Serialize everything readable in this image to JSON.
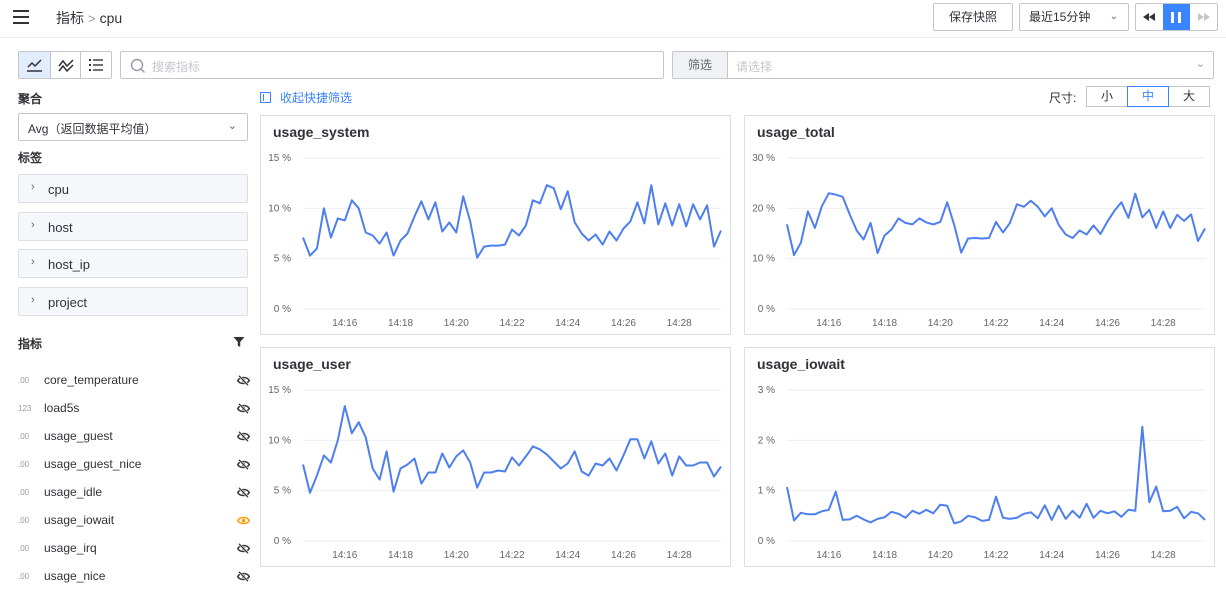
{
  "header": {
    "breadcrumb_root": "指标",
    "breadcrumb_sep": ">",
    "breadcrumb_current": "cpu",
    "save_label": "保存快照",
    "time_range": "最近15分钟"
  },
  "toolbar": {
    "search_placeholder": "搜索指标",
    "filter_label": "筛选",
    "filter_placeholder": "请选择",
    "collapse_label": "收起快捷筛选",
    "size_label": "尺寸:",
    "sizes": [
      "小",
      "中",
      "大"
    ],
    "active_size": "中"
  },
  "sidebar": {
    "agg_title": "聚合",
    "agg_value": "Avg（返回数据平均值）",
    "tags_title": "标签",
    "tags": [
      "cpu",
      "host",
      "host_ip",
      "project"
    ],
    "metrics_title": "指标",
    "metrics": [
      {
        "type": ".00",
        "name": "core_temperature",
        "visible": false
      },
      {
        "type": "123",
        "name": "load5s",
        "visible": false
      },
      {
        "type": ".00",
        "name": "usage_guest",
        "visible": false
      },
      {
        "type": ".00",
        "name": "usage_guest_nice",
        "visible": false
      },
      {
        "type": ".00",
        "name": "usage_idle",
        "visible": false
      },
      {
        "type": ".00",
        "name": "usage_iowait",
        "visible": true
      },
      {
        "type": ".00",
        "name": "usage_irq",
        "visible": false
      },
      {
        "type": ".00",
        "name": "usage_nice",
        "visible": false
      }
    ]
  },
  "colors": {
    "accent": "#3a84ff",
    "line": "#4e7ff0",
    "eye_active": "#ff9c01",
    "eye_hidden": "#313238"
  },
  "chart_data": [
    {
      "type": "line",
      "title": "usage_system",
      "y_ticks": [
        "0 %",
        "5 %",
        "10 %",
        "15 %"
      ],
      "ylim": [
        0,
        15
      ],
      "x_ticks": [
        "14:16",
        "14:18",
        "14:20",
        "14:22",
        "14:24",
        "14:26",
        "14:28"
      ],
      "x_tick_minutes": [
        16,
        18,
        20,
        22,
        24,
        26,
        28
      ],
      "xlim": [
        14.5,
        29.5
      ],
      "y": [
        7.1,
        5.3,
        6.0,
        10.0,
        7.1,
        9.0,
        8.8,
        10.8,
        10.0,
        7.6,
        7.3,
        6.5,
        7.6,
        5.3,
        6.8,
        7.5,
        9.2,
        10.7,
        8.9,
        10.6,
        7.7,
        8.6,
        7.6,
        11.2,
        8.7,
        5.1,
        6.2,
        6.3,
        6.3,
        6.4,
        7.9,
        7.3,
        8.3,
        10.8,
        10.5,
        12.3,
        12.0,
        9.9,
        11.7,
        8.6,
        7.5,
        6.8,
        7.4,
        6.4,
        7.7,
        6.8,
        8.0,
        8.7,
        10.6,
        8.5,
        12.3,
        8.4,
        10.5,
        8.3,
        10.4,
        8.2,
        10.4,
        8.9,
        10.3,
        6.2,
        7.8
      ]
    },
    {
      "type": "line",
      "title": "usage_total",
      "y_ticks": [
        "0 %",
        "10 %",
        "20 %",
        "30 %"
      ],
      "ylim": [
        0,
        30
      ],
      "x_ticks": [
        "14:16",
        "14:18",
        "14:20",
        "14:22",
        "14:24",
        "14:26",
        "14:28"
      ],
      "x_tick_minutes": [
        16,
        18,
        20,
        22,
        24,
        26,
        28
      ],
      "xlim": [
        14.5,
        29.5
      ],
      "y": [
        16.8,
        10.7,
        13.2,
        19.4,
        16.1,
        20.4,
        23.0,
        22.7,
        22.3,
        18.8,
        15.6,
        13.8,
        17.1,
        11.1,
        14.6,
        15.8,
        18.0,
        17.1,
        16.8,
        18.0,
        17.2,
        16.8,
        17.3,
        21.2,
        16.7,
        11.2,
        14.0,
        14.1,
        14.0,
        14.1,
        17.3,
        15.2,
        17.1,
        20.8,
        20.3,
        21.5,
        20.3,
        18.4,
        20.0,
        16.7,
        14.8,
        14.1,
        15.6,
        14.8,
        16.6,
        14.9,
        17.4,
        19.5,
        21.2,
        18.1,
        22.9,
        18.2,
        19.7,
        16.1,
        19.4,
        16.1,
        18.7,
        17.5,
        18.8,
        13.5,
        16.0
      ]
    },
    {
      "type": "line",
      "title": "usage_user",
      "y_ticks": [
        "0 %",
        "5 %",
        "10 %",
        "15 %"
      ],
      "ylim": [
        0,
        15
      ],
      "x_ticks": [
        "14:16",
        "14:18",
        "14:20",
        "14:22",
        "14:24",
        "14:26",
        "14:28"
      ],
      "x_tick_minutes": [
        16,
        18,
        20,
        22,
        24,
        26,
        28
      ],
      "xlim": [
        14.5,
        29.5
      ],
      "y": [
        7.6,
        4.8,
        6.5,
        8.5,
        7.8,
        10.0,
        13.4,
        10.7,
        11.8,
        10.3,
        7.2,
        6.1,
        8.9,
        4.9,
        7.2,
        7.6,
        8.2,
        5.7,
        6.8,
        6.8,
        8.7,
        7.3,
        8.4,
        9.0,
        7.8,
        5.3,
        6.8,
        6.8,
        7.0,
        6.9,
        8.3,
        7.5,
        8.4,
        9.4,
        9.1,
        8.6,
        7.9,
        7.2,
        7.7,
        8.9,
        6.9,
        6.5,
        7.7,
        7.5,
        8.2,
        7.0,
        8.5,
        10.1,
        10.1,
        8.2,
        9.9,
        7.7,
        8.7,
        6.5,
        8.4,
        7.5,
        7.5,
        7.8,
        7.8,
        6.4,
        7.4
      ]
    },
    {
      "type": "line",
      "title": "usage_iowait",
      "y_ticks": [
        "0 %",
        "1 %",
        "2 %",
        "3 %"
      ],
      "ylim": [
        0,
        3
      ],
      "x_ticks": [
        "14:16",
        "14:18",
        "14:20",
        "14:22",
        "14:24",
        "14:26",
        "14:28"
      ],
      "x_tick_minutes": [
        16,
        18,
        20,
        22,
        24,
        26,
        28
      ],
      "xlim": [
        14.5,
        29.5
      ],
      "y": [
        1.07,
        0.41,
        0.56,
        0.53,
        0.53,
        0.59,
        0.62,
        0.98,
        0.42,
        0.43,
        0.5,
        0.43,
        0.37,
        0.44,
        0.47,
        0.58,
        0.54,
        0.46,
        0.6,
        0.54,
        0.62,
        0.55,
        0.72,
        0.7,
        0.35,
        0.39,
        0.5,
        0.47,
        0.4,
        0.42,
        0.88,
        0.46,
        0.44,
        0.46,
        0.54,
        0.57,
        0.45,
        0.71,
        0.42,
        0.7,
        0.44,
        0.6,
        0.46,
        0.74,
        0.46,
        0.6,
        0.55,
        0.59,
        0.48,
        0.62,
        0.6,
        2.27,
        0.77,
        1.08,
        0.59,
        0.6,
        0.68,
        0.45,
        0.58,
        0.55,
        0.42
      ]
    }
  ]
}
